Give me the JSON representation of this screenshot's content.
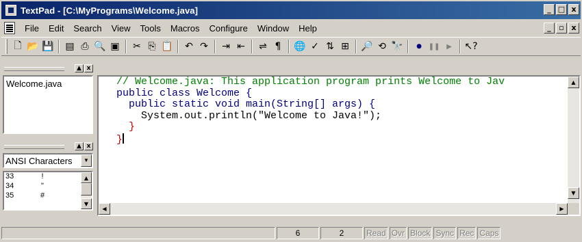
{
  "window": {
    "title": "TextPad - [C:\\MyPrograms\\Welcome.java]",
    "caption_buttons": {
      "minimize": "_",
      "maximize": "□",
      "close": "x"
    }
  },
  "menu": {
    "items": [
      "File",
      "Edit",
      "Search",
      "View",
      "Tools",
      "Macros",
      "Configure",
      "Window",
      "Help"
    ],
    "mdi_buttons": {
      "minimize": "_",
      "restore": "▫",
      "close": "x"
    }
  },
  "toolbar": {
    "icons": [
      "new-file",
      "open-folder",
      "save",
      "sep",
      "manage-files",
      "print",
      "print-preview",
      "word-wrap",
      "sep",
      "cut",
      "copy",
      "paste",
      "sep",
      "undo",
      "redo",
      "sep",
      "indent",
      "outdent",
      "sep",
      "reformat",
      "pilcrow",
      "sep",
      "web",
      "spell-check",
      "sort",
      "compare",
      "sep",
      "find",
      "replace",
      "find-in-files",
      "sep",
      "record-macro",
      "pause-macro",
      "play-macro",
      "sep",
      "help"
    ]
  },
  "doc_pane": {
    "documents": [
      "Welcome.java"
    ],
    "buttons": {
      "minimize": "▲",
      "close": "x"
    }
  },
  "clip_pane": {
    "charset": "ANSI Characters",
    "chars": [
      {
        "code": "33",
        "glyph": "!"
      },
      {
        "code": "34",
        "glyph": "\""
      },
      {
        "code": "35",
        "glyph": "#"
      }
    ],
    "buttons": {
      "minimize": "▲",
      "close": "x"
    }
  },
  "editor": {
    "lines": [
      "// Welcome.java: This application program prints Welcome to Jav",
      "public class Welcome {",
      "  public static void main(String[] args) {",
      "    System.out.println(\"Welcome to Java!\");",
      "  }",
      "}"
    ]
  },
  "status": {
    "line": "6",
    "column": "2",
    "flags": [
      "Read",
      "Ovr",
      "Block",
      "Sync",
      "Rec",
      "Caps"
    ]
  }
}
